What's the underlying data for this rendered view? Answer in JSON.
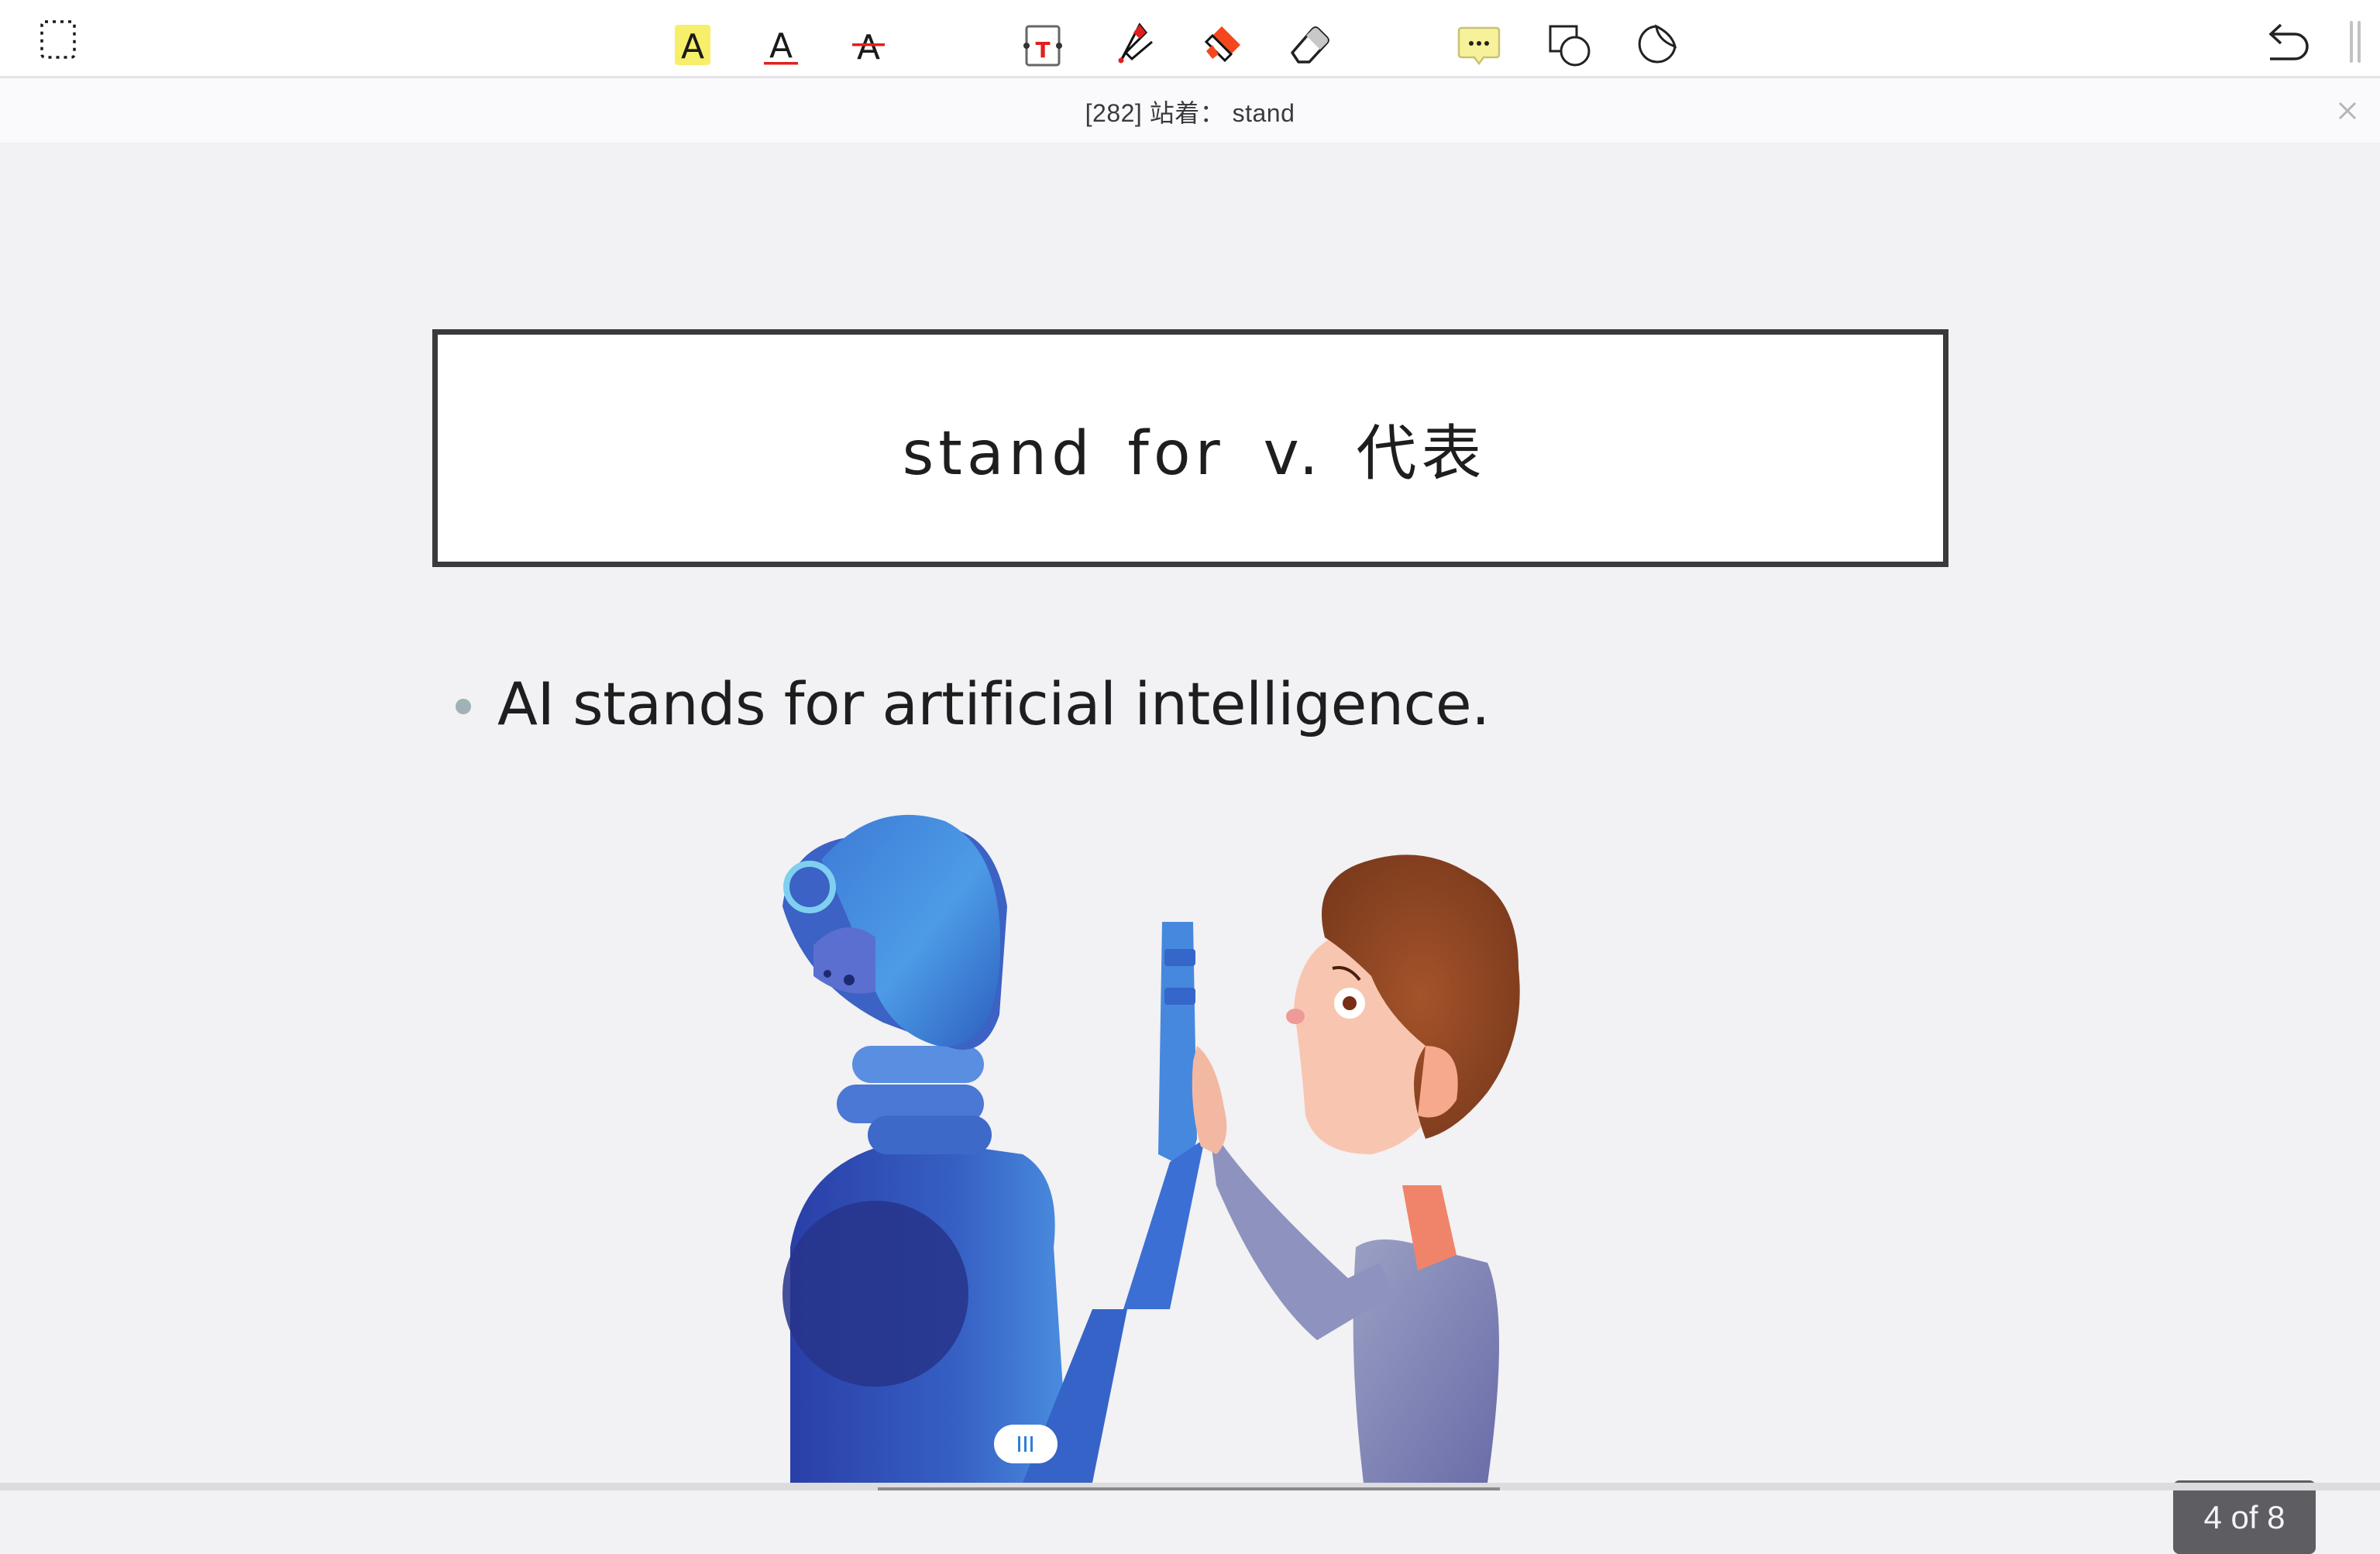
{
  "toolbar": {
    "tools": [
      {
        "id": "select",
        "icon": "marquee-select-icon",
        "label": "Select region"
      },
      {
        "id": "highlight",
        "icon": "text-highlight-icon",
        "label": "A",
        "color": "#f7ef6a"
      },
      {
        "id": "underline",
        "icon": "text-underline-icon",
        "label": "A",
        "color": "#e02020"
      },
      {
        "id": "strikethrough",
        "icon": "text-strikethrough-icon",
        "label": "A",
        "color": "#e02020"
      },
      {
        "id": "textbox",
        "icon": "text-box-icon",
        "label": "T",
        "color": "#e02020"
      },
      {
        "id": "pen",
        "icon": "pen-icon",
        "color": "#e02020"
      },
      {
        "id": "marker",
        "icon": "highlighter-marker-icon",
        "color": "#f4471e"
      },
      {
        "id": "eraser",
        "icon": "eraser-icon"
      },
      {
        "id": "note",
        "icon": "comment-note-icon",
        "color": "#f7f19a"
      },
      {
        "id": "shape",
        "icon": "shapes-icon"
      },
      {
        "id": "sticker",
        "icon": "sticker-icon"
      },
      {
        "id": "undo",
        "icon": "undo-icon"
      },
      {
        "id": "more",
        "icon": "sidebar-handle-icon"
      }
    ]
  },
  "infobar": {
    "title": "[282] 站着： stand",
    "close_icon": "close-icon"
  },
  "slide": {
    "title_term": "stand for",
    "title_pos": "v.",
    "title_meaning": "代表",
    "bullets": [
      "AI stands for artificial intelligence."
    ],
    "illustration": "robot-and-boy-high-five"
  },
  "pager": {
    "label": "4 of 8",
    "current": 4,
    "total": 8
  },
  "colors": {
    "accent_red": "#e02020",
    "highlight_yellow": "#f7ef6a",
    "badge_bg": "#5e5d62",
    "page_bg": "#f2f1f4"
  }
}
